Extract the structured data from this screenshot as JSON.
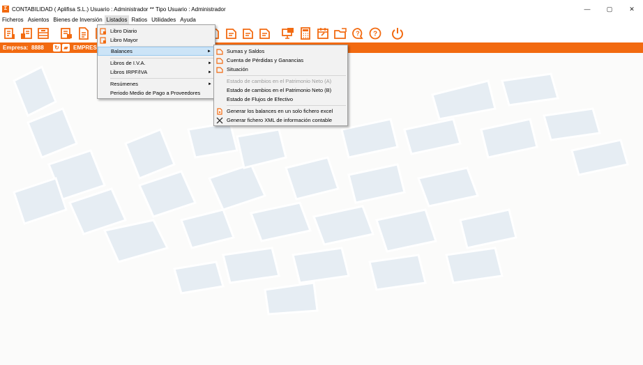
{
  "window": {
    "title": "CONTABILIDAD  ( Aplifisa S.L.)  Usuario : Administrador  **  Tipo Usuario : Administrador",
    "icon": "app-icon",
    "minimize": "—",
    "maximize": "▢",
    "close": "✕"
  },
  "menubar": {
    "items": [
      "Ficheros",
      "Asientos",
      "Bienes de Inversión",
      "Listados",
      "Ratios",
      "Utilidades",
      "Ayuda"
    ]
  },
  "empresa": {
    "label": "Empresa:",
    "code": "8888",
    "name": "EMPRESA"
  },
  "listados_menu": {
    "items": [
      {
        "label": "Libro Diario",
        "icon": "book-icon"
      },
      {
        "label": "Libro Mayor",
        "icon": "book-icon"
      },
      {
        "label": "Balances",
        "submenu": true,
        "selected": true
      },
      {
        "label": "Libros de I.V.A.",
        "submenu": true
      },
      {
        "label": "Libros IRPF/IVA",
        "submenu": true
      },
      {
        "label": "Resúmenes",
        "submenu": true
      },
      {
        "label": "Periodo Medio de Pago a Proveedores"
      }
    ]
  },
  "balances_menu": {
    "items": [
      {
        "label": "Sumas y Saldos",
        "icon": "balance-icon"
      },
      {
        "label": "Cuenta de Pérdidas y Ganancias",
        "icon": "balance-icon"
      },
      {
        "label": "Situación",
        "icon": "balance-icon"
      },
      {
        "label": "Estado de cambios en el  Patrimonio Neto (A)",
        "disabled": true
      },
      {
        "label": "Estado de cambios en el  Patrimonio Neto (B)"
      },
      {
        "label": "Estado de Flujos de Efectivo"
      },
      {
        "label": "Generar los balances en un solo fichero excel",
        "icon": "excel-icon"
      },
      {
        "label": "Generar fichero XML de información contable",
        "icon": "xml-icon"
      }
    ]
  },
  "colors": {
    "accent": "#f26a10",
    "menu_bg": "#f2f2f2",
    "selection": "#cce4f7"
  },
  "toolbar": {
    "icons": [
      "ledger-icon",
      "journal-icon",
      "print-icon",
      "accounts-icon",
      "document-icon",
      "report-icon",
      "list-icon",
      "balance-icon",
      "balance-icon",
      "balance-icon",
      "balance-icon",
      "monitor-icon",
      "calculator-icon",
      "calendar-icon",
      "folders-icon",
      "help-chat-icon",
      "help-icon",
      "power-icon"
    ]
  }
}
